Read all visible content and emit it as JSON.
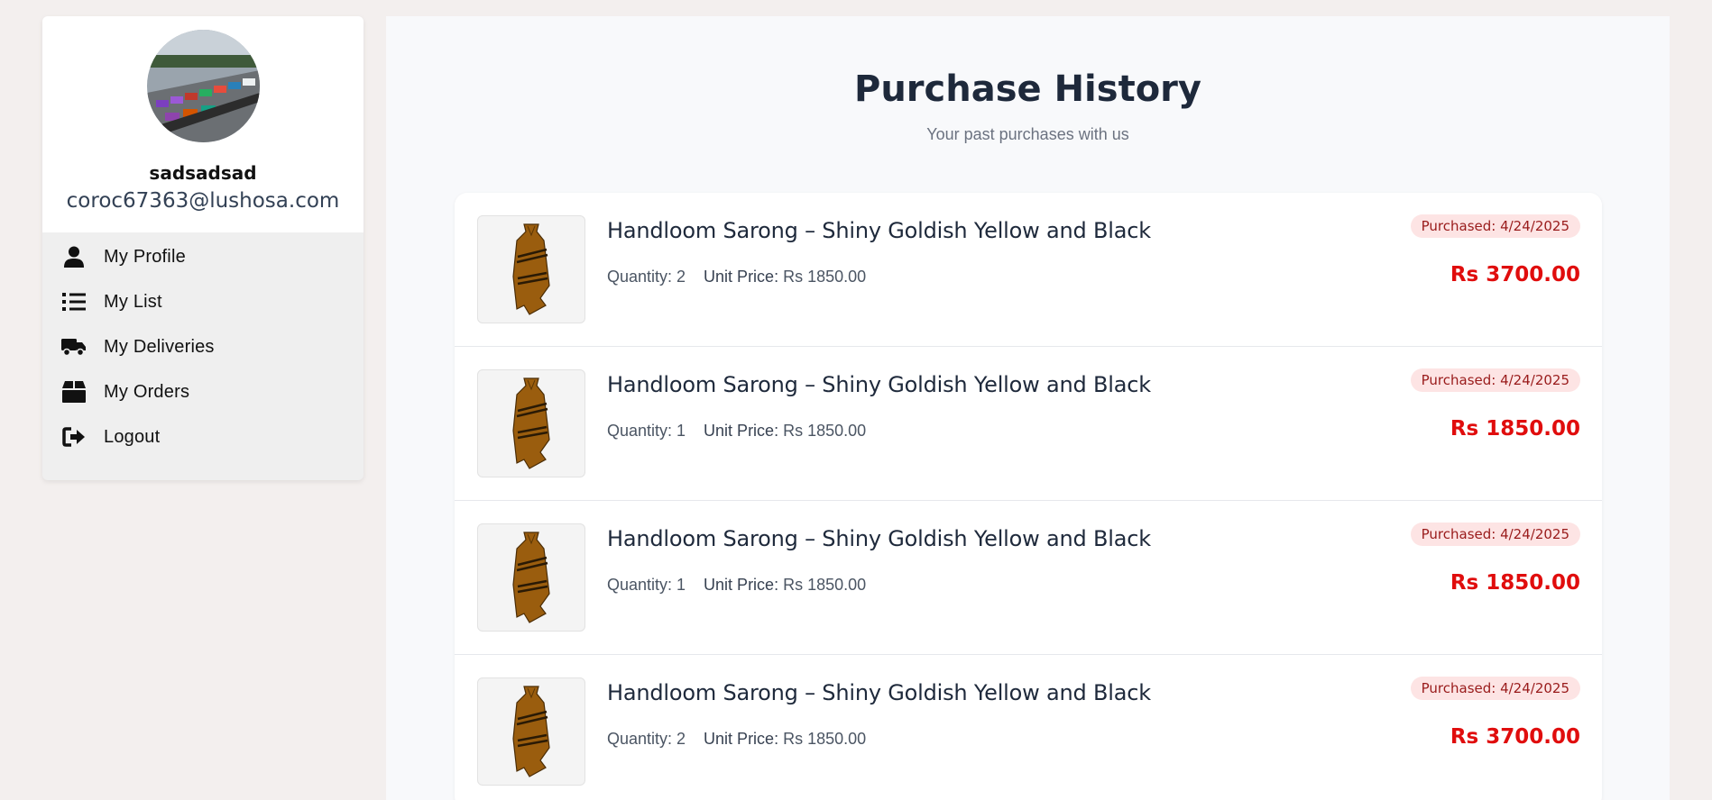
{
  "sidebar": {
    "username": "sadsadsad",
    "email": "coroc67363@lushosa.com",
    "items": [
      {
        "label": "My Profile",
        "icon": "user-icon"
      },
      {
        "label": "My List",
        "icon": "list-icon"
      },
      {
        "label": "My Deliveries",
        "icon": "truck-icon"
      },
      {
        "label": "My Orders",
        "icon": "box-icon"
      },
      {
        "label": "Logout",
        "icon": "logout-icon"
      }
    ]
  },
  "main": {
    "title": "Purchase History",
    "subtitle": "Your past purchases with us"
  },
  "purchases": [
    {
      "name": "Handloom Sarong – Shiny Goldish Yellow and Black",
      "quantity_label": "Quantity: 2",
      "unit_price_key": "Unit Price:",
      "unit_price_value": "Rs 1850.00",
      "date": "Purchased: 4/24/2025",
      "total": "Rs 3700.00"
    },
    {
      "name": "Handloom Sarong – Shiny Goldish Yellow and Black",
      "quantity_label": "Quantity: 1",
      "unit_price_key": "Unit Price:",
      "unit_price_value": "Rs 1850.00",
      "date": "Purchased: 4/24/2025",
      "total": "Rs 1850.00"
    },
    {
      "name": "Handloom Sarong – Shiny Goldish Yellow and Black",
      "quantity_label": "Quantity: 1",
      "unit_price_key": "Unit Price:",
      "unit_price_value": "Rs 1850.00",
      "date": "Purchased: 4/24/2025",
      "total": "Rs 1850.00"
    },
    {
      "name": "Handloom Sarong – Shiny Goldish Yellow and Black",
      "quantity_label": "Quantity: 2",
      "unit_price_key": "Unit Price:",
      "unit_price_value": "Rs 1850.00",
      "date": "Purchased: 4/24/2025",
      "total": "Rs 3700.00"
    }
  ],
  "colors": {
    "accent_price": "#e00d0d",
    "badge_bg": "#fde4e4",
    "badge_text": "#991b1b"
  }
}
